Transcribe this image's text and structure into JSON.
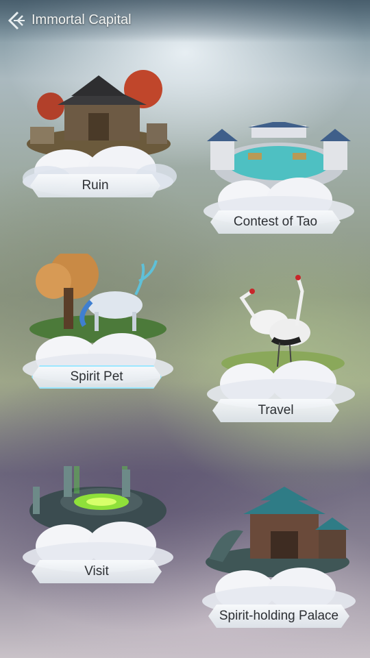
{
  "header": {
    "title": "Immortal Capital",
    "back_icon": "back-arrow-icon"
  },
  "locations": [
    {
      "id": "ruin",
      "label": "Ruin",
      "icon": "ruined-temple-icon"
    },
    {
      "id": "contest",
      "label": "Contest of Tao",
      "icon": "arena-pavilion-icon"
    },
    {
      "id": "spirit-pet",
      "label": "Spirit Pet",
      "icon": "spirit-deer-icon",
      "selected": true
    },
    {
      "id": "travel",
      "label": "Travel",
      "icon": "cranes-icon"
    },
    {
      "id": "visit",
      "label": "Visit",
      "icon": "portal-circle-icon"
    },
    {
      "id": "palace",
      "label": "Spirit-holding Palace",
      "icon": "palace-icon"
    }
  ],
  "colors": {
    "plate_text": "#2c2f33",
    "plate_bg": "#eef2f5",
    "selected_glow": "#96e6ff",
    "title_text": "#f2f4f2"
  }
}
